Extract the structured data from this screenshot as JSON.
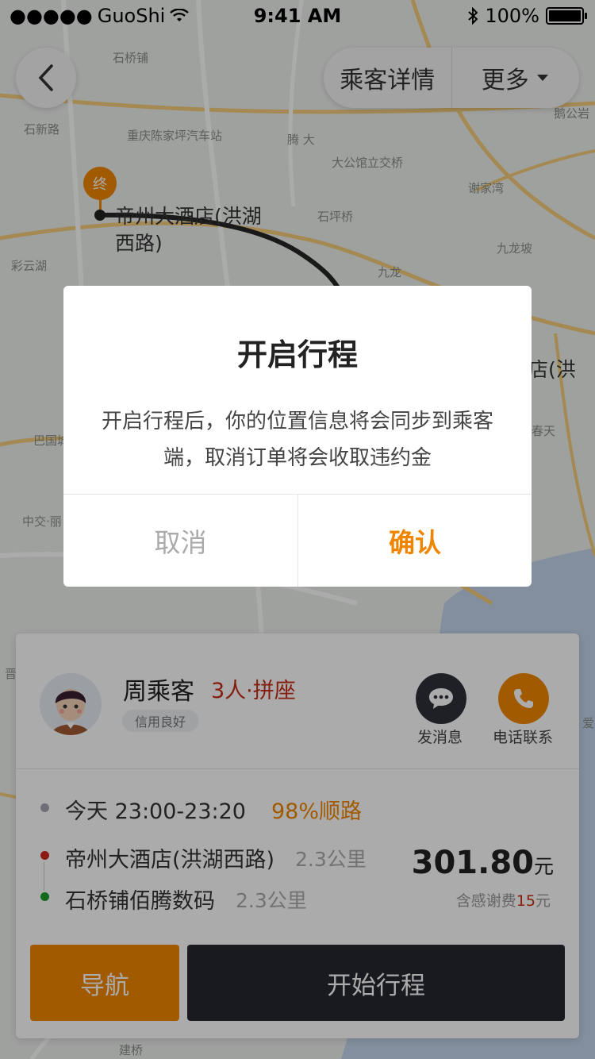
{
  "status_bar": {
    "carrier": "GuoShi",
    "time": "9:41 AM",
    "battery": "100%"
  },
  "header": {
    "passenger_details_label": "乘客详情",
    "more_label": "更多"
  },
  "map": {
    "labels": [
      "石桥铺",
      "石新路",
      "重庆陈家坪汽车站",
      "腾 大",
      "大公馆立交桥",
      "谢家湾",
      "石坪桥",
      "九龙坡",
      "九龙",
      "彩云湖",
      "巴国城",
      "中交·丽",
      "春天",
      "鹅公岩",
      "爱",
      "晋",
      "建桥"
    ],
    "end_marker_text": "终",
    "end_place": "帝州大酒店(洪湖西路)",
    "right_place_fragment": "店(洪"
  },
  "passenger": {
    "name": "周乘客",
    "seats": "3人·拼座",
    "credit_badge": "信用良好",
    "message_label": "发消息",
    "call_label": "电话联系"
  },
  "trip": {
    "time": "今天 23:00-23:20",
    "route_match": "98%顺路",
    "pickup": {
      "name": "帝州大酒店(洪湖西路)",
      "distance": "2.3公里"
    },
    "dropoff": {
      "name": "石桥铺佰腾数码",
      "distance": "2.3公里"
    },
    "price": "301.80",
    "price_unit": "元",
    "price_note_prefix": "含感谢费",
    "price_note_tip": "15",
    "price_note_suffix": "元"
  },
  "actions": {
    "navigate": "导航",
    "start_trip": "开始行程"
  },
  "dialog": {
    "title": "开启行程",
    "body": "开启行程后，你的位置信息将会同步到乘客端，取消订单将会收取违约金",
    "cancel": "取消",
    "confirm": "确认"
  },
  "colors": {
    "accent": "#f08600",
    "dark": "#262830",
    "red": "#c62b16",
    "map_road": "#f2c46a"
  }
}
